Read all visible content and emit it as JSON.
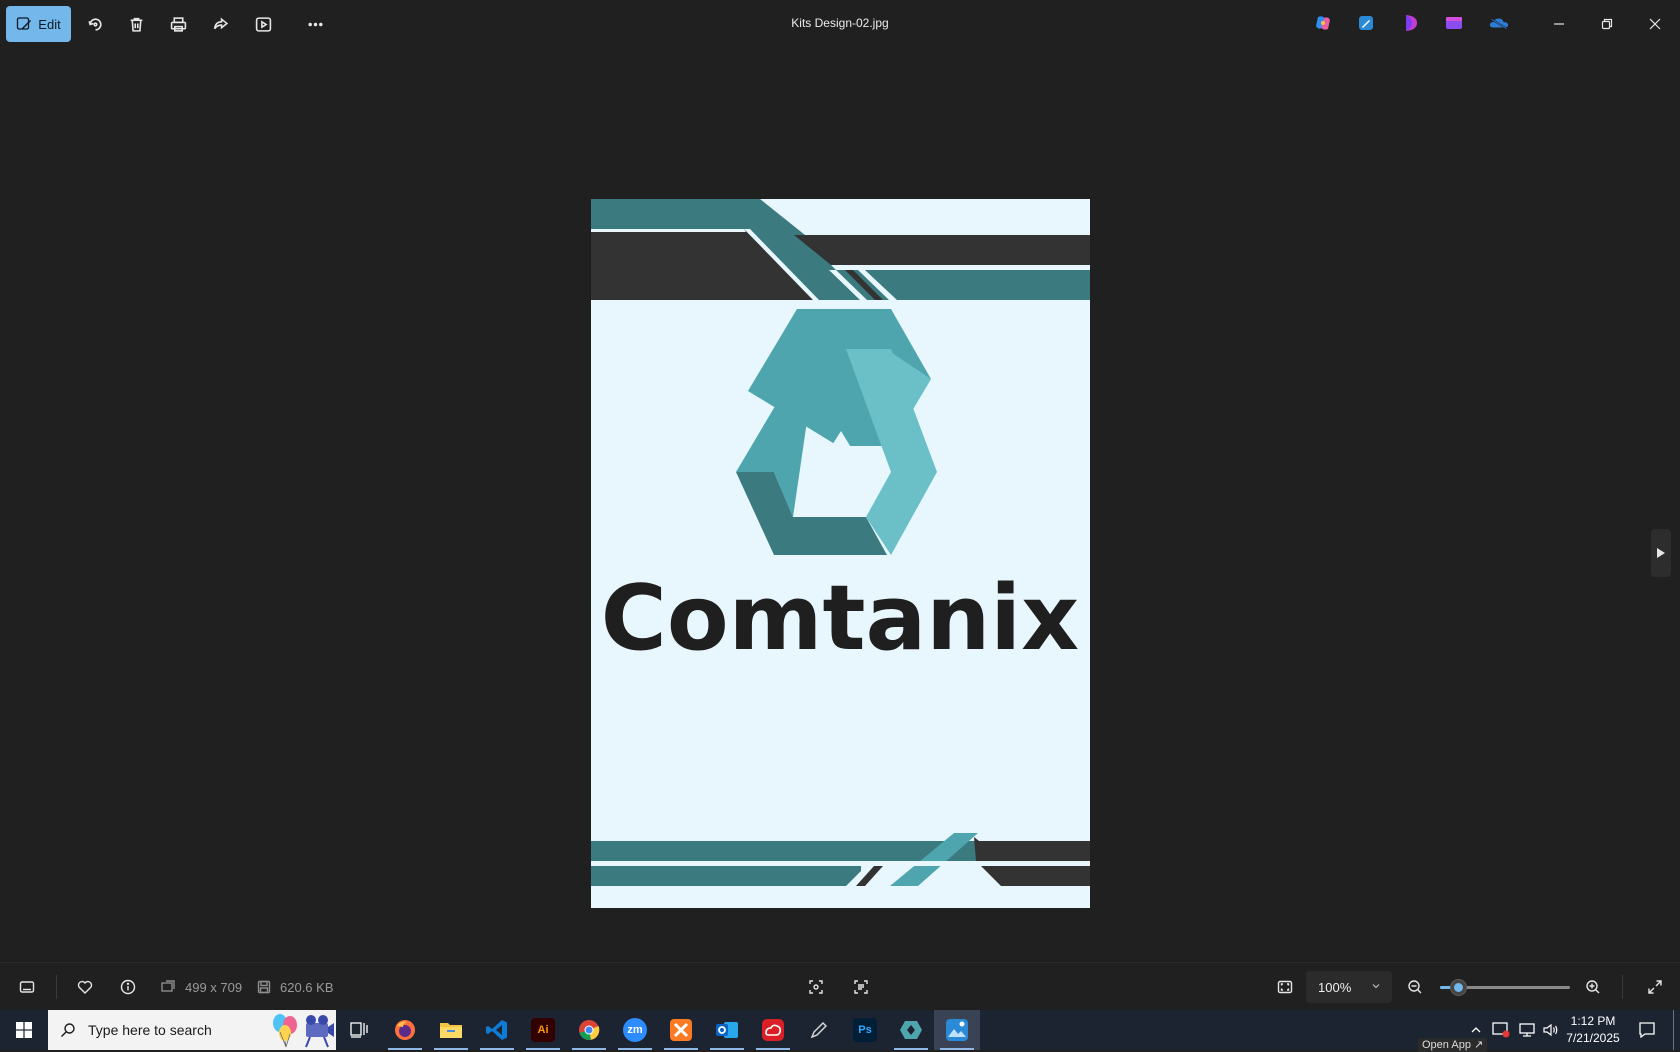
{
  "toolbar": {
    "edit_label": "Edit",
    "file_title": "Kits Design-02.jpg",
    "tools": [
      "rotate-icon",
      "delete-icon",
      "print-icon",
      "share-icon",
      "slideshow-icon",
      "more-icon"
    ],
    "apps": [
      "copilot-icon",
      "photo-editor-icon",
      "clipchamp-icon",
      "designer-icon",
      "onedrive-icon"
    ]
  },
  "image": {
    "brand_name": "Comtanix",
    "colors": {
      "background": "#e8f6fd",
      "teal_dark": "#3b7b80",
      "teal_mid": "#4ea5ad",
      "teal_light": "#6bc0c8",
      "charcoal": "#333333",
      "text": "#1f1f1f"
    }
  },
  "status": {
    "dimensions": "499 x 709",
    "file_size": "620.6 KB",
    "zoom_label": "100%",
    "zoom_level_fraction": 0.14
  },
  "taskbar": {
    "search_placeholder": "Type here to search",
    "apps": [
      {
        "name": "task-view",
        "color": "#1c2331",
        "label": ""
      },
      {
        "name": "firefox",
        "color": "#ff7139",
        "label": ""
      },
      {
        "name": "file-explorer",
        "color": "#f4c542",
        "label": ""
      },
      {
        "name": "vscode",
        "color": "#0e7bd4",
        "label": ""
      },
      {
        "name": "illustrator",
        "color": "#330000",
        "label": "Ai"
      },
      {
        "name": "chrome",
        "color": "#34a853",
        "label": ""
      },
      {
        "name": "zoom",
        "color": "#2d8cff",
        "label": "zm"
      },
      {
        "name": "xampp",
        "color": "#fb7a24",
        "label": ""
      },
      {
        "name": "outlook",
        "color": "#0a64c8",
        "label": ""
      },
      {
        "name": "creative-cloud",
        "color": "#da1f26",
        "label": ""
      },
      {
        "name": "pen-tool",
        "color": "#1c2331",
        "label": ""
      },
      {
        "name": "photoshop",
        "color": "#001e36",
        "label": "Ps"
      },
      {
        "name": "comtanix-app",
        "color": "#4ea5ad",
        "label": ""
      },
      {
        "name": "photos",
        "color": "#2a8ad6",
        "label": ""
      }
    ],
    "time": "1:12 PM",
    "date": "7/21/2025",
    "tooltip": "Open App ↗"
  }
}
